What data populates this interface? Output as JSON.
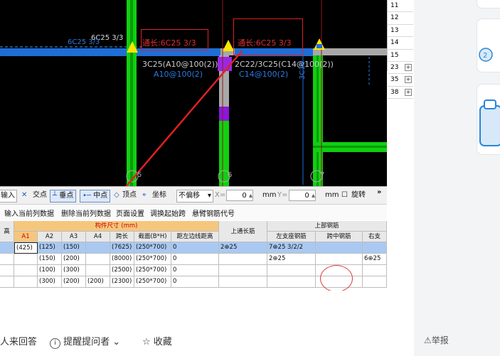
{
  "cad": {
    "labels": {
      "top_label_1": "6C25 3/3",
      "top_label_2": "6C25 3/3",
      "tongchang_1": "通长:6C25 3/3",
      "tongchang_2": "通长:6C25 3/3",
      "beam_1_reinf": "3C25(A10@100(2))",
      "beam_1_stirrup": "A10@100(2)",
      "beam_2_reinf": "2C22/3C25(C14@100(2))",
      "beam_2_stirrup": "C14@100(2)",
      "vertical_label": "3C18",
      "axis_5": "5",
      "axis_6": "6",
      "axis_7": "7"
    }
  },
  "row_numbers": [
    {
      "num": "11",
      "expand": ""
    },
    {
      "num": "12",
      "expand": ""
    },
    {
      "num": "13",
      "expand": ""
    },
    {
      "num": "14",
      "expand": ""
    },
    {
      "num": "15",
      "expand": ""
    },
    {
      "num": "23",
      "expand": "+"
    },
    {
      "num": "35",
      "expand": "+"
    },
    {
      "num": "38",
      "expand": "+"
    }
  ],
  "toolbar1": {
    "input": "输入",
    "intersection": "交点",
    "perpendicular": "垂点",
    "midpoint": "中点",
    "vertex": "顶点",
    "coordinate": "坐标",
    "offset": "不偏移",
    "x_label": "X=",
    "x_value": "0",
    "x_unit": "mm",
    "y_label": "Y=",
    "y_value": "0",
    "y_unit": "mm",
    "rotate": "旋转",
    "more": "»"
  },
  "toolbar2": {
    "input_col_data": "输入当前列数据",
    "delete_col_data": "删除当前列数据",
    "page_setup": "页面设置",
    "swap_start": "调换起始跨",
    "cantilever_code": "悬臂钢筋代号"
  },
  "table": {
    "header_group_1": "构件尺寸 (mm)",
    "header_group_2": "上部钢筋",
    "col_height": "高",
    "col_a1": "A1",
    "col_a2": "A2",
    "col_a3": "A3",
    "col_a4": "A4",
    "col_span": "跨长",
    "col_section": "截面(B*H)",
    "col_distance": "距左边线距离",
    "col_top_through": "上通长筋",
    "col_left_support": "左支座钢筋",
    "col_mid_span": "跨中钢筋",
    "col_right_support": "右支",
    "rows": [
      {
        "a1": "(425)",
        "a2": "(125)",
        "a3": "(150)",
        "a4": "",
        "span": "(7625)",
        "section": "(250*700)",
        "dist": "0",
        "through": "2⊕25",
        "left": "7⊕25 3/2/2",
        "mid": "",
        "right": ""
      },
      {
        "a1": "",
        "a2": "(150)",
        "a3": "(200)",
        "a4": "",
        "span": "(8000)",
        "section": "(250*700)",
        "dist": "0",
        "through": "",
        "left": "2⊕25",
        "mid": "",
        "right": "6⊕25"
      },
      {
        "a1": "",
        "a2": "(100)",
        "a3": "(300)",
        "a4": "",
        "span": "(2500)",
        "section": "(250*700)",
        "dist": "0",
        "through": "",
        "left": "",
        "mid": "",
        "right": ""
      },
      {
        "a1": "",
        "a2": "(300)",
        "a3": "(200)",
        "a4": "(200)",
        "span": "(2300)",
        "section": "(250*700)",
        "dist": "0",
        "through": "",
        "left": "",
        "mid": "",
        "right": ""
      }
    ]
  },
  "bottom": {
    "answer": "人来回答",
    "remind": "提醒提问者",
    "favorite": "收藏",
    "report": "举报"
  }
}
